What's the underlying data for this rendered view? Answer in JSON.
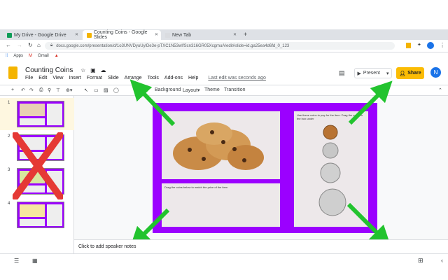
{
  "browser": {
    "tabs": [
      {
        "title": "My Drive - Google Drive",
        "favicon_color": "#0f9d58",
        "active": false
      },
      {
        "title": "Counting Coins - Google Slides",
        "favicon_color": "#f4b400",
        "active": true
      },
      {
        "title": "New Tab",
        "favicon_color": "#dadce0",
        "active": false
      }
    ],
    "new_tab_symbol": "+",
    "url": "docs.google.com/presentation/d/1o3UNVDyuUylDe3e-pTXC1N53wIfScn316GR05XcgmuA/edit#slide=id.ga25ea4d6fd_0_123",
    "bookmarks": [
      "Apps",
      "Gmail"
    ]
  },
  "docs": {
    "title": "Counting Coins",
    "menu": [
      "File",
      "Edit",
      "View",
      "Insert",
      "Format",
      "Slide",
      "Arrange",
      "Tools",
      "Add-ons",
      "Help"
    ],
    "last_edit": "Last edit was seconds ago",
    "present_label": "Present",
    "share_label": "Share",
    "avatar_initial": "N",
    "toolbar": {
      "background": "Background",
      "layout": "Layout",
      "theme": "Theme",
      "transition": "Transition"
    }
  },
  "filmstrip": {
    "slide_numbers": [
      "1",
      "2",
      "3",
      "4"
    ]
  },
  "slide": {
    "coins_caption": "Use these coins to pay for the item. Drag the coins to the box under",
    "drag_caption": "Drag the coins below to match the price of the item"
  },
  "notes_placeholder": "Click to add speaker notes",
  "colors": {
    "slide_bg": "#9b00ff",
    "arrow": "#22c32e",
    "cross": "#e53935",
    "share": "#fbbc04"
  }
}
